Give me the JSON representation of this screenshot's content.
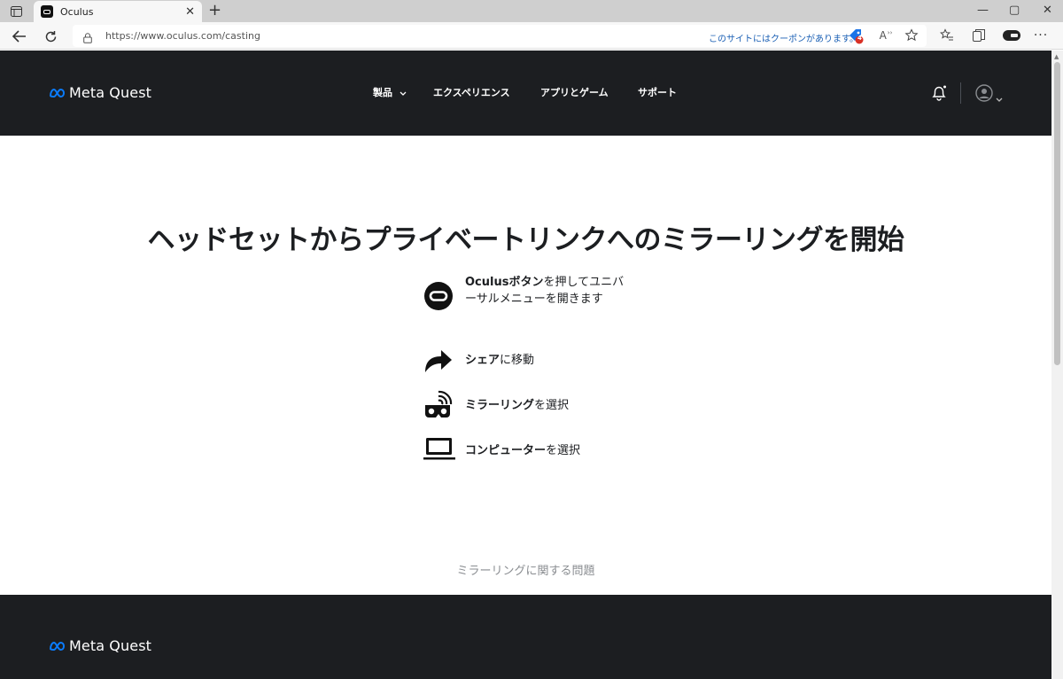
{
  "browser": {
    "tab_title": "Oculus",
    "tab_close": "✕",
    "new_tab": "+",
    "url": "https://www.oculus.com/casting",
    "coupon_text": "このサイトにはクーポンがあります。",
    "coupon_badge": "4",
    "read_aloud_label": "A",
    "window_controls": {
      "minimize": "—",
      "maximize": "▢",
      "close": "✕"
    }
  },
  "header": {
    "logo_text": "Meta Quest",
    "nav": [
      {
        "label": "製品"
      },
      {
        "label": "エクスペリエンス"
      },
      {
        "label": "アプリとゲーム"
      },
      {
        "label": "サポート"
      }
    ]
  },
  "main": {
    "headline": "ヘッドセットからプライベートリンクへのミラーリングを開始",
    "steps": [
      {
        "strong": "Oculusボタン",
        "rest": "を押してユニバーサルメニューを開きます",
        "icon": "oculus-button-icon"
      },
      {
        "strong": "シェア",
        "rest": "に移動",
        "icon": "share-arrow-icon"
      },
      {
        "strong": "ミラーリング",
        "rest": "を選択",
        "icon": "mirroring-headset-icon"
      },
      {
        "strong": "コンピューター",
        "rest": "を選択",
        "icon": "laptop-icon"
      }
    ],
    "issue_link": "ミラーリングに関する問題"
  },
  "footer": {
    "logo_text": "Meta Quest"
  },
  "colors": {
    "dark": "#1c1e21",
    "meta_blue": "#0a7cff",
    "link_grey": "#8a8d91"
  }
}
